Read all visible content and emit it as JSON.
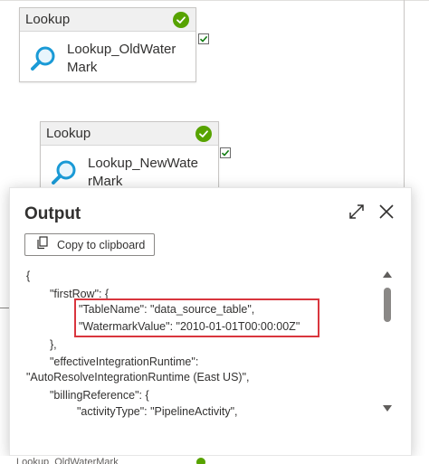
{
  "activities": [
    {
      "type": "Lookup",
      "name": "Lookup_OldWaterMark"
    },
    {
      "type": "Lookup",
      "name": "Lookup_NewWaterMark"
    }
  ],
  "output_panel": {
    "title": "Output",
    "copy_label": "Copy to clipboard",
    "json_lines": [
      "{",
      "\"firstRow\": {",
      "\"TableName\": \"data_source_table\",",
      "\"WatermarkValue\": \"2010-01-01T00:00:00Z\"",
      "},",
      "\"effectiveIntegrationRuntime\":",
      "\"AutoResolveIntegrationRuntime (East US)\",",
      "\"billingReference\": {",
      "\"activityType\": \"PipelineActivity\","
    ]
  },
  "status_row": {
    "text": "Lookup_OldWaterMark"
  },
  "colors": {
    "success": "#57a300",
    "highlight": "#d9363e",
    "lookup_icon": "#1a9ad6"
  },
  "icons": [
    "check-circle-icon",
    "lookup-magnifier-icon",
    "checkbox-icon",
    "expand-icon",
    "close-icon",
    "copy-icon",
    "scroll-up-icon",
    "scroll-down-icon"
  ]
}
